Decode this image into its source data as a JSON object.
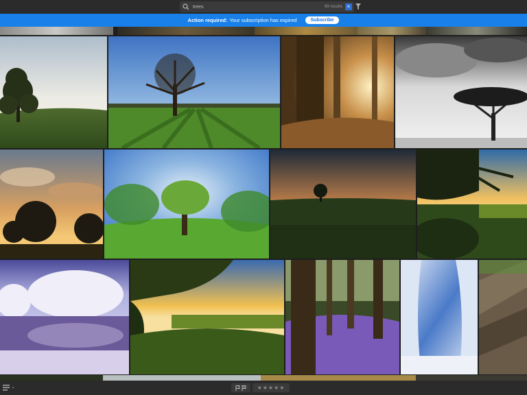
{
  "search": {
    "query": "trees",
    "result_count": "89 results",
    "clear_label": "×"
  },
  "banner": {
    "title": "Action required:",
    "message": "Your subscription has expired",
    "button_label": "Subscribe"
  },
  "bottom": {
    "caret": "⌄",
    "stars": "★★★★★"
  },
  "colors": {
    "accent": "#1880e8",
    "topbar": "#2b2b2b",
    "background": "#1e1e1e"
  },
  "grid": {
    "row1": [
      "tree-sunset-hill",
      "oak-tree-field",
      "forest-sunbeams",
      "bw-acacia-tree"
    ],
    "row2": [
      "tree-silhouette-sky",
      "zoom-blur-tree",
      "lone-tree-dusk",
      "tree-branches-sunset"
    ],
    "row3": [
      "infrared-trees-lake",
      "hedge-field-sunset",
      "bluebell-forest",
      "frosty-trees",
      "blur-bark"
    ]
  }
}
